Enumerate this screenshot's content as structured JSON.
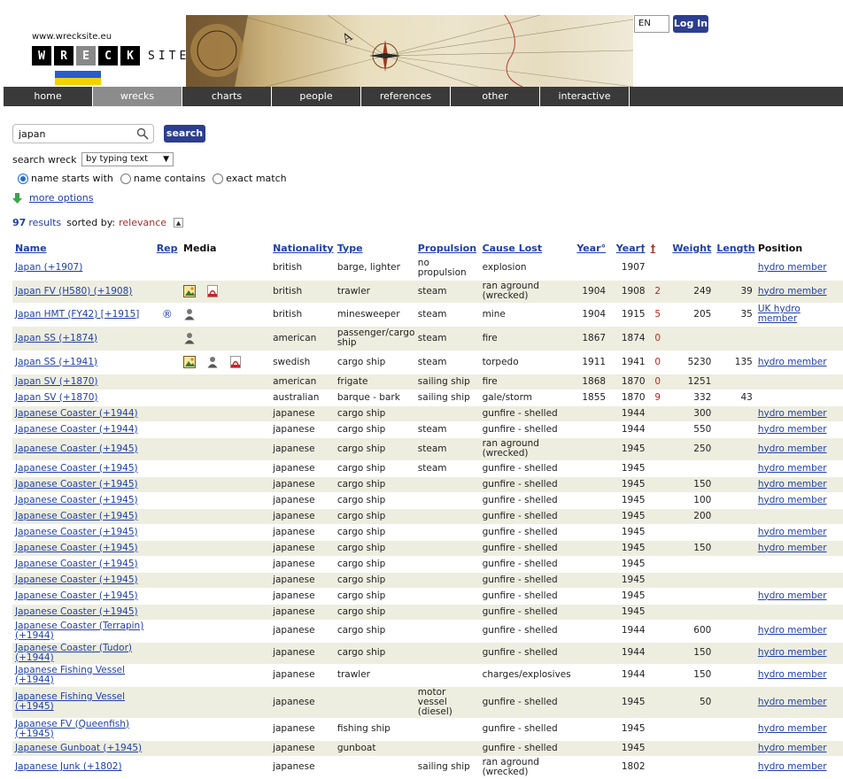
{
  "header": {
    "site_url": "www.wrecksite.eu",
    "logo_letters": [
      "W",
      "R",
      "E",
      "C",
      "K"
    ],
    "logo_suffix": "SITE",
    "language": "EN",
    "login_label": "Log In"
  },
  "nav": {
    "items": [
      {
        "label": "home"
      },
      {
        "label": "wrecks"
      },
      {
        "label": "charts"
      },
      {
        "label": "people"
      },
      {
        "label": "references"
      },
      {
        "label": "other"
      },
      {
        "label": "interactive"
      }
    ]
  },
  "search": {
    "query": "japan",
    "button_label": "search",
    "mode_label": "search wreck",
    "mode_value": "by typing text",
    "options": [
      {
        "label": "name starts with",
        "checked": true
      },
      {
        "label": "name contains",
        "checked": false
      },
      {
        "label": "exact match",
        "checked": false
      }
    ],
    "more_options_label": "more options"
  },
  "results": {
    "count": "97",
    "results_word": "results",
    "sorted_label": "sorted by:",
    "sort_value": "relevance"
  },
  "table": {
    "headers": {
      "name": "Name",
      "rep": "Rep",
      "media": "Media",
      "nationality": "Nationality",
      "type": "Type",
      "propulsion": "Propulsion",
      "cause_lost": "Cause Lost",
      "year_built": "Year°",
      "year_lost": "Year†",
      "dead": "†",
      "weight": "Weight",
      "length": "Length",
      "position": "Position"
    },
    "rows": [
      {
        "name": "Japan (+1907)",
        "rep": "",
        "media": [],
        "nationality": "british",
        "type": "barge, lighter",
        "propulsion": "no propulsion",
        "cause": "explosion",
        "built": "",
        "lost": "1907",
        "dead": "",
        "weight": "",
        "length": "",
        "position": "hydro member"
      },
      {
        "name": "Japan FV (H580) (+1908)",
        "rep": "",
        "media": [
          "image",
          "pdf"
        ],
        "nationality": "british",
        "type": "trawler",
        "propulsion": "steam",
        "cause": "ran aground (wrecked)",
        "built": "1904",
        "lost": "1908",
        "dead": "2",
        "weight": "249",
        "length": "39",
        "position": "hydro member"
      },
      {
        "name": "Japan HMT (FY42) [+1915]",
        "rep": "®",
        "media": [
          "person"
        ],
        "nationality": "british",
        "type": "minesweeper",
        "propulsion": "steam",
        "cause": "mine",
        "built": "1904",
        "lost": "1915",
        "dead": "5",
        "weight": "205",
        "length": "35",
        "position": "UK hydro member"
      },
      {
        "name": "Japan SS (+1874)",
        "rep": "",
        "media": [
          "person"
        ],
        "nationality": "american",
        "type": "passenger/cargo ship",
        "propulsion": "steam",
        "cause": "fire",
        "built": "1867",
        "lost": "1874",
        "dead": "0",
        "weight": "",
        "length": "",
        "position": ""
      },
      {
        "name": "Japan SS (+1941)",
        "rep": "",
        "media": [
          "image",
          "person",
          "pdf"
        ],
        "nationality": "swedish",
        "type": "cargo ship",
        "propulsion": "steam",
        "cause": "torpedo",
        "built": "1911",
        "lost": "1941",
        "dead": "0",
        "weight": "5230",
        "length": "135",
        "position": "hydro member"
      },
      {
        "name": "Japan SV (+1870)",
        "rep": "",
        "media": [],
        "nationality": "american",
        "type": "frigate",
        "propulsion": "sailing ship",
        "cause": "fire",
        "built": "1868",
        "lost": "1870",
        "dead": "0",
        "weight": "1251",
        "length": "",
        "position": ""
      },
      {
        "name": "Japan SV (+1870)",
        "rep": "",
        "media": [],
        "nationality": "australian",
        "type": "barque - bark",
        "propulsion": "sailing ship",
        "cause": "gale/storm",
        "built": "1855",
        "lost": "1870",
        "dead": "9",
        "weight": "332",
        "length": "43",
        "position": ""
      },
      {
        "name": "Japanese Coaster (+1944)",
        "rep": "",
        "media": [],
        "nationality": "japanese",
        "type": "cargo ship",
        "propulsion": "",
        "cause": "gunfire - shelled",
        "built": "",
        "lost": "1944",
        "dead": "",
        "weight": "300",
        "length": "",
        "position": "hydro member"
      },
      {
        "name": "Japanese Coaster (+1944)",
        "rep": "",
        "media": [],
        "nationality": "japanese",
        "type": "cargo ship",
        "propulsion": "steam",
        "cause": "gunfire - shelled",
        "built": "",
        "lost": "1944",
        "dead": "",
        "weight": "550",
        "length": "",
        "position": "hydro member"
      },
      {
        "name": "Japanese Coaster (+1945)",
        "rep": "",
        "media": [],
        "nationality": "japanese",
        "type": "cargo ship",
        "propulsion": "steam",
        "cause": "ran aground (wrecked)",
        "built": "",
        "lost": "1945",
        "dead": "",
        "weight": "250",
        "length": "",
        "position": "hydro member"
      },
      {
        "name": "Japanese Coaster (+1945)",
        "rep": "",
        "media": [],
        "nationality": "japanese",
        "type": "cargo ship",
        "propulsion": "steam",
        "cause": "gunfire - shelled",
        "built": "",
        "lost": "1945",
        "dead": "",
        "weight": "",
        "length": "",
        "position": "hydro member"
      },
      {
        "name": "Japanese Coaster (+1945)",
        "rep": "",
        "media": [],
        "nationality": "japanese",
        "type": "cargo ship",
        "propulsion": "",
        "cause": "gunfire - shelled",
        "built": "",
        "lost": "1945",
        "dead": "",
        "weight": "150",
        "length": "",
        "position": "hydro member"
      },
      {
        "name": "Japanese Coaster (+1945)",
        "rep": "",
        "media": [],
        "nationality": "japanese",
        "type": "cargo ship",
        "propulsion": "",
        "cause": "gunfire - shelled",
        "built": "",
        "lost": "1945",
        "dead": "",
        "weight": "100",
        "length": "",
        "position": "hydro member"
      },
      {
        "name": "Japanese Coaster (+1945)",
        "rep": "",
        "media": [],
        "nationality": "japanese",
        "type": "cargo ship",
        "propulsion": "",
        "cause": "gunfire - shelled",
        "built": "",
        "lost": "1945",
        "dead": "",
        "weight": "200",
        "length": "",
        "position": ""
      },
      {
        "name": "Japanese Coaster (+1945)",
        "rep": "",
        "media": [],
        "nationality": "japanese",
        "type": "cargo ship",
        "propulsion": "",
        "cause": "gunfire - shelled",
        "built": "",
        "lost": "1945",
        "dead": "",
        "weight": "",
        "length": "",
        "position": "hydro member"
      },
      {
        "name": "Japanese Coaster (+1945)",
        "rep": "",
        "media": [],
        "nationality": "japanese",
        "type": "cargo ship",
        "propulsion": "",
        "cause": "gunfire - shelled",
        "built": "",
        "lost": "1945",
        "dead": "",
        "weight": "150",
        "length": "",
        "position": "hydro member"
      },
      {
        "name": "Japanese Coaster (+1945)",
        "rep": "",
        "media": [],
        "nationality": "japanese",
        "type": "cargo ship",
        "propulsion": "",
        "cause": "gunfire - shelled",
        "built": "",
        "lost": "1945",
        "dead": "",
        "weight": "",
        "length": "",
        "position": ""
      },
      {
        "name": "Japanese Coaster (+1945)",
        "rep": "",
        "media": [],
        "nationality": "japanese",
        "type": "cargo ship",
        "propulsion": "",
        "cause": "gunfire - shelled",
        "built": "",
        "lost": "1945",
        "dead": "",
        "weight": "",
        "length": "",
        "position": ""
      },
      {
        "name": "Japanese Coaster (+1945)",
        "rep": "",
        "media": [],
        "nationality": "japanese",
        "type": "cargo ship",
        "propulsion": "",
        "cause": "gunfire - shelled",
        "built": "",
        "lost": "1945",
        "dead": "",
        "weight": "",
        "length": "",
        "position": "hydro member"
      },
      {
        "name": "Japanese Coaster (+1945)",
        "rep": "",
        "media": [],
        "nationality": "japanese",
        "type": "cargo ship",
        "propulsion": "",
        "cause": "gunfire - shelled",
        "built": "",
        "lost": "1945",
        "dead": "",
        "weight": "",
        "length": "",
        "position": ""
      },
      {
        "name": "Japanese Coaster (Terrapin) (+1944)",
        "rep": "",
        "media": [],
        "nationality": "japanese",
        "type": "cargo ship",
        "propulsion": "",
        "cause": "gunfire - shelled",
        "built": "",
        "lost": "1944",
        "dead": "",
        "weight": "600",
        "length": "",
        "position": "hydro member"
      },
      {
        "name": "Japanese Coaster (Tudor) (+1944)",
        "rep": "",
        "media": [],
        "nationality": "japanese",
        "type": "cargo ship",
        "propulsion": "",
        "cause": "gunfire - shelled",
        "built": "",
        "lost": "1944",
        "dead": "",
        "weight": "150",
        "length": "",
        "position": "hydro member"
      },
      {
        "name": "Japanese Fishing Vessel (+1944)",
        "rep": "",
        "media": [],
        "nationality": "japanese",
        "type": "trawler",
        "propulsion": "",
        "cause": "charges/explosives",
        "built": "",
        "lost": "1944",
        "dead": "",
        "weight": "150",
        "length": "",
        "position": "hydro member"
      },
      {
        "name": "Japanese Fishing Vessel (+1945)",
        "rep": "",
        "media": [],
        "nationality": "japanese",
        "type": "",
        "propulsion": "motor vessel (diesel)",
        "cause": "gunfire - shelled",
        "built": "",
        "lost": "1945",
        "dead": "",
        "weight": "50",
        "length": "",
        "position": "hydro member"
      },
      {
        "name": "Japanese FV (Queenfish) (+1945)",
        "rep": "",
        "media": [],
        "nationality": "japanese",
        "type": "fishing ship",
        "propulsion": "",
        "cause": "gunfire - shelled",
        "built": "",
        "lost": "1945",
        "dead": "",
        "weight": "",
        "length": "",
        "position": "hydro member"
      },
      {
        "name": "Japanese Gunboat (+1945)",
        "rep": "",
        "media": [],
        "nationality": "japanese",
        "type": "gunboat",
        "propulsion": "",
        "cause": "gunfire - shelled",
        "built": "",
        "lost": "1945",
        "dead": "",
        "weight": "",
        "length": "",
        "position": "hydro member"
      },
      {
        "name": "Japanese Junk (+1802)",
        "rep": "",
        "media": [],
        "nationality": "japanese",
        "type": "",
        "propulsion": "sailing ship",
        "cause": "ran aground (wrecked)",
        "built": "",
        "lost": "1802",
        "dead": "",
        "weight": "",
        "length": "",
        "position": "hydro member"
      }
    ]
  }
}
